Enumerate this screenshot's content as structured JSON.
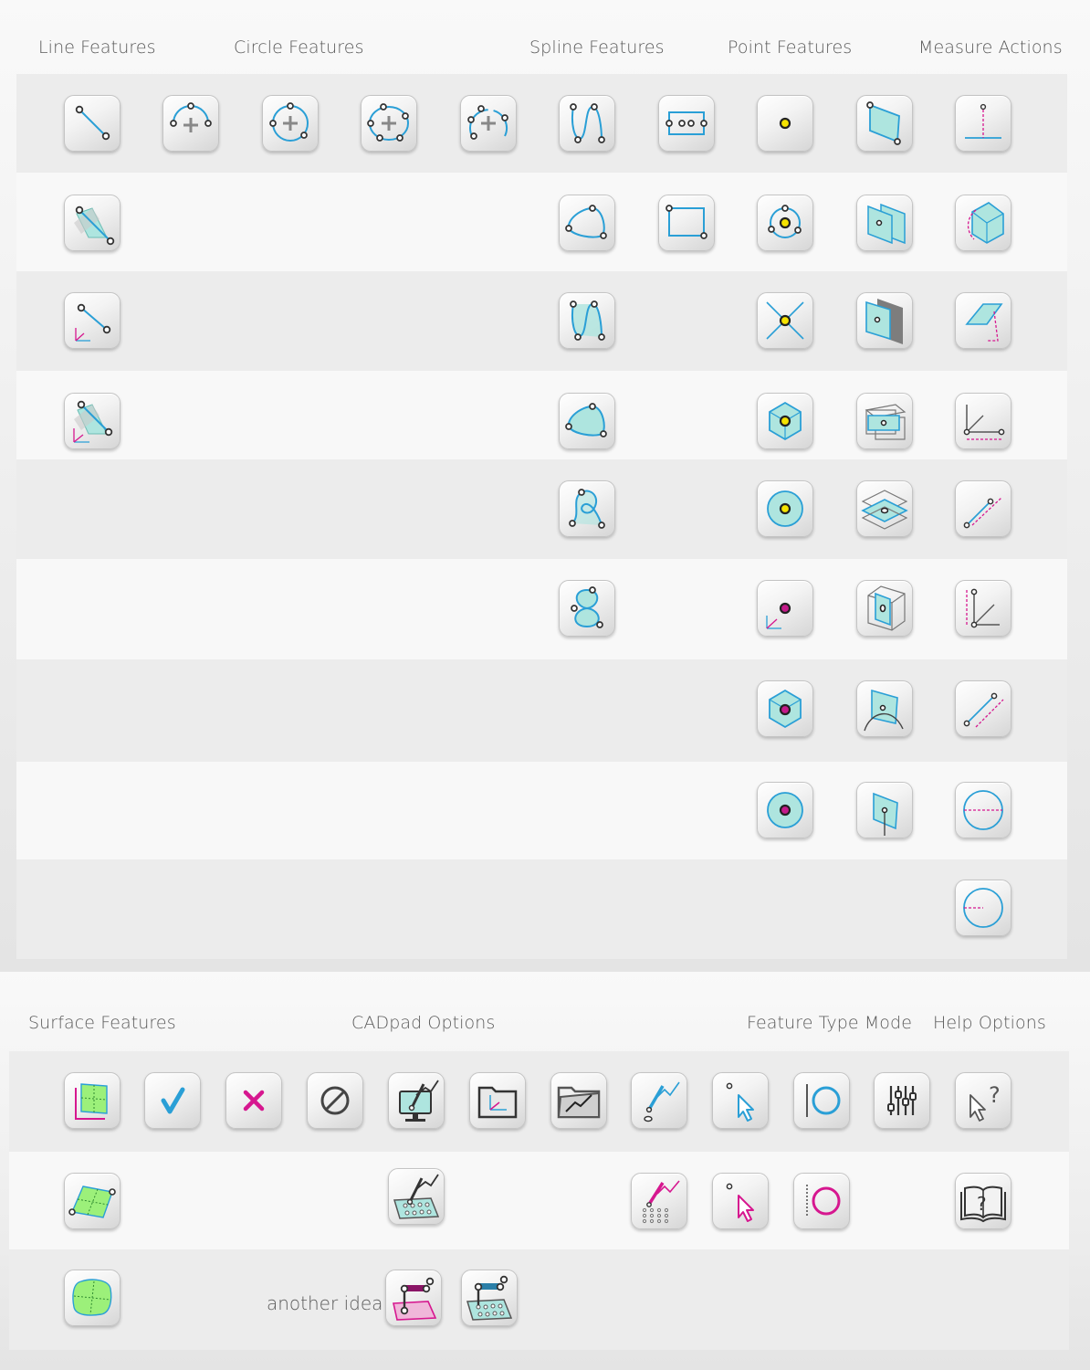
{
  "headings": {
    "line": "Line Features",
    "circle": "Circle Features",
    "spline": "Spline Features",
    "point": "Point Features",
    "measure": "Measure Actions",
    "surface": "Surface Features",
    "cadpad": "CADpad Options",
    "mode": "Feature Type Mode",
    "help": "Help Options"
  },
  "note": "another idea",
  "colors": {
    "accent_blue": "#2a9fd6",
    "accent_magenta": "#d6178f",
    "fill_cyan": "#aee5df",
    "fill_green": "#9cf07a",
    "point_yellow": "#f5e300",
    "band_dark": "#ececec",
    "band_light": "#f8f8f8"
  },
  "icons": {
    "line": [
      "line-2point-icon",
      "line-2point-plane-projected-icon",
      "line-axis-icon",
      "line-axis-plane-projected-icon"
    ],
    "circle": [
      "arc-3point-icon",
      "circle-3point-icon",
      "circle-4point-icon",
      "arc-partial-icon"
    ],
    "spline": [
      "spline-open-icon",
      "spline-closed-icon",
      "spline-open-filled-icon",
      "spline-closed-filled-icon",
      "spline-loop-icon",
      "spline-figure8-icon"
    ],
    "slot": [
      "slot-icon",
      "rectangle-icon"
    ],
    "point": [
      "point-icon",
      "point-circle-center-icon",
      "point-intersection-icon",
      "point-box-center-icon",
      "point-target-icon",
      "point-axis-magenta-icon",
      "point-box-center-magenta-icon",
      "point-target-magenta-icon"
    ],
    "plane": [
      "plane-icon",
      "plane-parallel-icon",
      "plane-offset-icon",
      "plane-box-icon",
      "plane-stack-icon",
      "plane-cube-icon",
      "plane-curve-icon",
      "plane-normal-icon"
    ],
    "measure": [
      "measure-distance-icon",
      "measure-cube-angle-icon",
      "measure-slope-icon",
      "measure-horizontal-icon",
      "measure-angle-icon",
      "measure-vertical-angle-icon",
      "measure-parallel-icon",
      "measure-diameter-icon",
      "measure-radius-icon"
    ],
    "surface": [
      "surface-grid-icon",
      "surface-points-icon",
      "surface-rounded-icon"
    ],
    "cadpad": [
      "accept-icon",
      "reject-icon",
      "disable-icon",
      "monitor-probe-icon",
      "folder-axis-icon",
      "folder-graph-icon"
    ],
    "cadpad_row2": [
      "probe-points-panel-icon"
    ],
    "ideas": [
      "probe-magenta-area-icon",
      "probe-dot-grid-icon"
    ],
    "mode": [
      "probe-graph-icon",
      "probe-graph-dots-icon",
      "select-cursor-icon",
      "select-cursor-magenta-icon",
      "feature-circle-icon",
      "feature-circle-magenta-icon",
      "sliders-icon"
    ],
    "help": [
      "help-cursor-icon",
      "help-book-icon"
    ]
  }
}
